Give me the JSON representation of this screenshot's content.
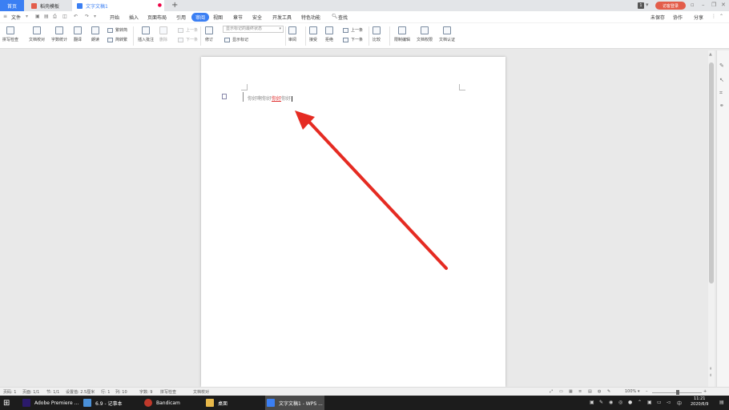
{
  "tabs": [
    {
      "label": "首页"
    },
    {
      "label": "稻壳模板"
    },
    {
      "label": "文字文稿1"
    }
  ],
  "title_right": {
    "login": "访客登录",
    "badge": "1"
  },
  "menu": {
    "file": "文件",
    "items": [
      "开始",
      "插入",
      "页面布局",
      "引用",
      "审阅",
      "视图",
      "章节",
      "安全",
      "开发工具",
      "特色功能"
    ],
    "search": "查找",
    "unsaved": "未保存",
    "collab": "协作",
    "share": "分享"
  },
  "ribbon": {
    "spell": "拼写检查",
    "proof": "文档校对",
    "wordcount": "字数统计",
    "translate": "翻译",
    "read": "朗读",
    "simp2trad": "繁转简",
    "trad2simp": "简转繁",
    "insert_comment": "插入批注",
    "delete": "删除",
    "prev": "上一条",
    "next": "下一条",
    "revise": "修订",
    "display_dropdown": "显示标记的最终状态",
    "show_marks": "显示标记",
    "review": "审阅",
    "accept": "接受",
    "reject": "拒绝",
    "prev2": "上一条",
    "next2": "下一条",
    "compare": "比较",
    "restrict": "限制编辑",
    "permission": "文档权限",
    "certify": "文档认证"
  },
  "document": {
    "text_before": "你好啊你好",
    "text_red": "你好",
    "text_after": "你好"
  },
  "status": {
    "page": "页码: 1",
    "pages": "页面: 1/1",
    "section": "节: 1/1",
    "setting": "设置值: 2.5厘米",
    "row": "行: 1",
    "col": "列: 10",
    "words": "字数: 9",
    "spell": "拼写检查",
    "proof": "文档校对",
    "zoom": "100%"
  },
  "taskbar": [
    {
      "label": "Adobe Premiere ...",
      "color": "#2b1a6b"
    },
    {
      "label": "6.9 - 记事本",
      "color": "#4a90d9"
    },
    {
      "label": "Bandicam",
      "color": "#c0392b"
    },
    {
      "label": "桌面",
      "color": "#e8b84a"
    },
    {
      "label": "文字文稿1 - WPS ...",
      "color": "#3b7ff3"
    }
  ],
  "tray": {
    "ime": "中",
    "time": "11:21",
    "date": "2020/6/9"
  },
  "colors": {
    "accent": "#3b7ff3",
    "arrow": "#e52b22",
    "login": "#e35d4a"
  }
}
